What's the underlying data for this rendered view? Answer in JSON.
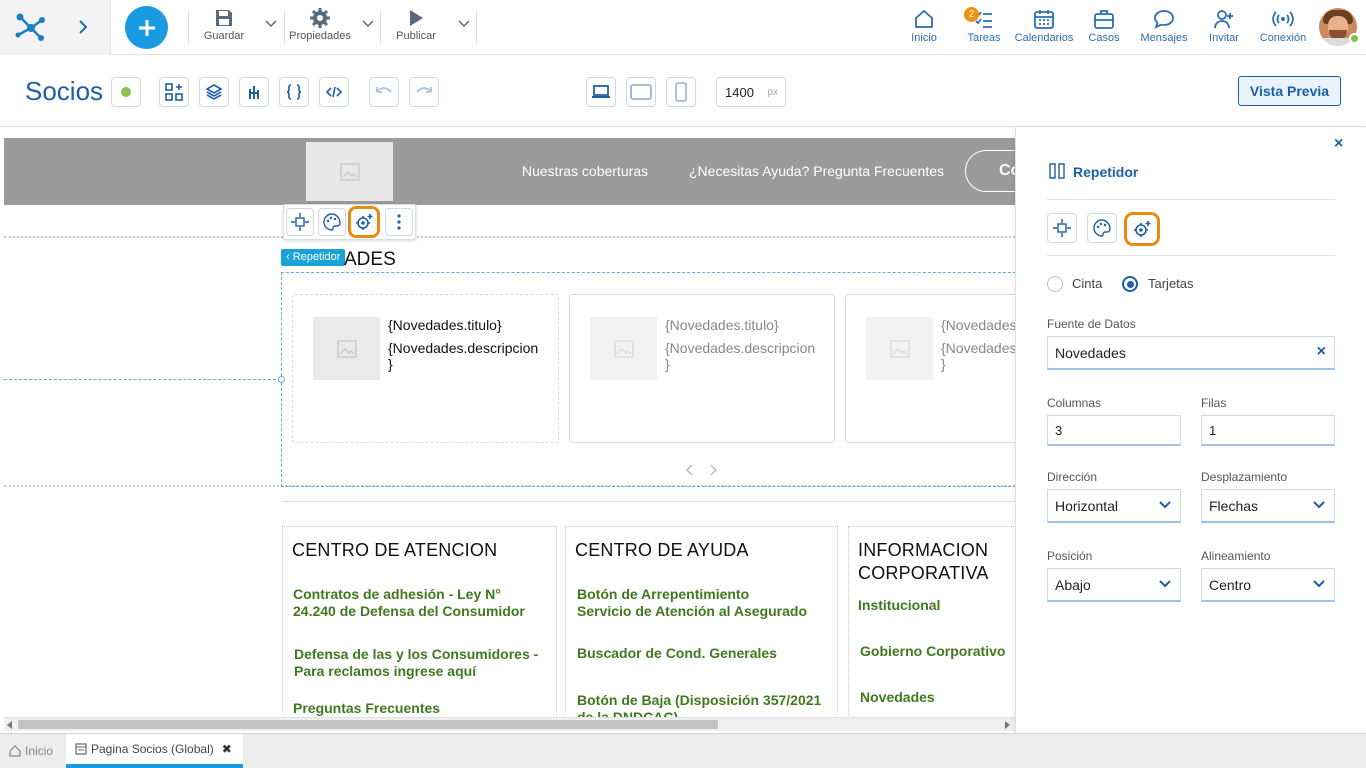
{
  "toolbar": {
    "save": "Guardar",
    "properties": "Propiedades",
    "publish": "Publicar"
  },
  "nav": {
    "home": "Inicio",
    "tasks": "Tareas",
    "tasks_badge": "2",
    "calendars": "Calendarios",
    "cases": "Casos",
    "messages": "Mensajes",
    "invite": "Invitar",
    "connection": "Conexión"
  },
  "page": {
    "title": "Socios",
    "width_value": "1400",
    "width_unit": "px",
    "preview": "Vista Previa"
  },
  "site": {
    "menu1": "Nuestras coberturas",
    "menu2": "¿Necesitas Ayuda? Pregunta Frecuentes",
    "btn_fragment": "Co",
    "section_title": "ADES",
    "repeater_tag": "Repetidor"
  },
  "cards": [
    {
      "title": "{Novedades.titulo}",
      "desc": "{Novedades.descripcion",
      "close": "}"
    },
    {
      "title": "{Novedades.titulo}",
      "desc": "{Novedades.descripcion",
      "close": "}"
    },
    {
      "title": "{Novedades",
      "desc": "{Novedades",
      "close": "}"
    }
  ],
  "footer": {
    "col1": {
      "title": "CENTRO DE ATENCION",
      "links": [
        "Contratos de adhesión - Ley N°",
        "24.240 de Defensa del Consumidor",
        "Defensa de las y los Consumidores -",
        "Para reclamos ingrese aquí",
        "Preguntas Frecuentes"
      ]
    },
    "col2": {
      "title": "CENTRO DE AYUDA",
      "links": [
        "Botón de Arrepentimiento",
        "Servicio de Atención al Asegurado",
        "Buscador de Cond. Generales",
        "Botón de Baja (Disposición 357/2021",
        "de la DNDCAC)"
      ]
    },
    "col3": {
      "title1": "INFORMACION",
      "title2": "CORPORATIVA",
      "links": [
        "Institucional",
        "Gobierno Corporativo",
        "Novedades"
      ]
    }
  },
  "panel": {
    "title": "Repetidor",
    "close": "×",
    "radio1": "Cinta",
    "radio2": "Tarjetas",
    "source_label": "Fuente de Datos",
    "source_value": "Novedades",
    "source_clear": "×",
    "columns_label": "Columnas",
    "columns_value": "3",
    "rows_label": "Filas",
    "rows_value": "1",
    "direction_label": "Dirección",
    "direction_value": "Horizontal",
    "scroll_label": "Desplazamiento",
    "scroll_value": "Flechas",
    "position_label": "Posición",
    "position_value": "Abajo",
    "align_label": "Alineamiento",
    "align_value": "Centro"
  },
  "tabs": {
    "home": "Inicio",
    "page": "Pagina Socios (Global)",
    "close": "✖"
  },
  "colors": {
    "accent": "#1a9ae0",
    "link_green": "#3f7a1f",
    "highlight": "#e88a12",
    "nav_blue": "#2d6db3"
  }
}
